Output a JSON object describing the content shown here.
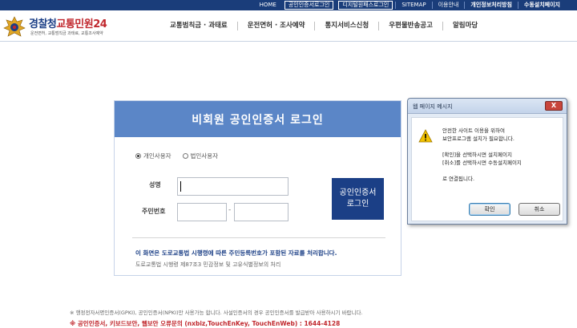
{
  "topnav": {
    "items": [
      {
        "label": "HOME",
        "style": "plain"
      },
      {
        "label": "공인인증서로그인",
        "style": "box"
      },
      {
        "label": "디지털원패스로그인",
        "style": "box"
      },
      {
        "label": "SITEMAP",
        "style": "plain"
      },
      {
        "label": "이용안내",
        "style": "plain"
      },
      {
        "label": "개인정보처리방침",
        "style": "bold"
      },
      {
        "label": "수동설치페이지",
        "style": "bold"
      }
    ]
  },
  "header": {
    "logo_part1": "경찰청",
    "logo_part2": "교통민원24",
    "logo_sub": "운전면허, 교통범칙금 과태료, 교통조사예약",
    "nav": [
      "교통범칙금 · 과태료",
      "운전면허 · 조사예약",
      "통지서비스신청",
      "우편물반송공고",
      "알림마당"
    ]
  },
  "login": {
    "title": "비회원 공인인증서 로그인",
    "radio_personal": "개인사용자",
    "radio_corporate": "법인사용자",
    "name_label": "성명",
    "ssn_label": "주민번호",
    "ssn_separator": "-",
    "button_line1": "공인인증서",
    "button_line2": "로그인",
    "notice1": "이 화면은 도로교통법 시행령에 따른 주민등록번호가 포함된 자료를 처리합니다.",
    "notice2": "도로교통법 시행령 제87조3 민감정보 및 고유식별정보의 처리"
  },
  "footer": {
    "line1": "※ 행정전자서명인증서(GPKI), 공인인증서(NPKI)만 사용가능 합니다. 사설인증서의 경우 공인인증서를 발급받아 사용하시기 바랍니다.",
    "line2": "※ 공인인증서, 키보드보안, 웹보안 오류문의 (nxbiz,TouchEnKey, TouchEnWeb) : 1644-4128"
  },
  "dialog": {
    "title": "웹 페이지 메시지",
    "close": "X",
    "lines": [
      "안전한 사이트 이용을 위하여",
      "보안프로그램 설치가 필요합니다.",
      "",
      "[확인]을 선택하시면 설치페이지",
      "[취소]를 선택하시면 수동설치페이지",
      "",
      "로 연결됩니다."
    ],
    "ok": "확인",
    "cancel": "취소"
  },
  "colors": {
    "topbar": "#1a3d7a",
    "login_header": "#5b86c7",
    "primary_button": "#1b3f86",
    "accent_red": "#c0272d"
  }
}
